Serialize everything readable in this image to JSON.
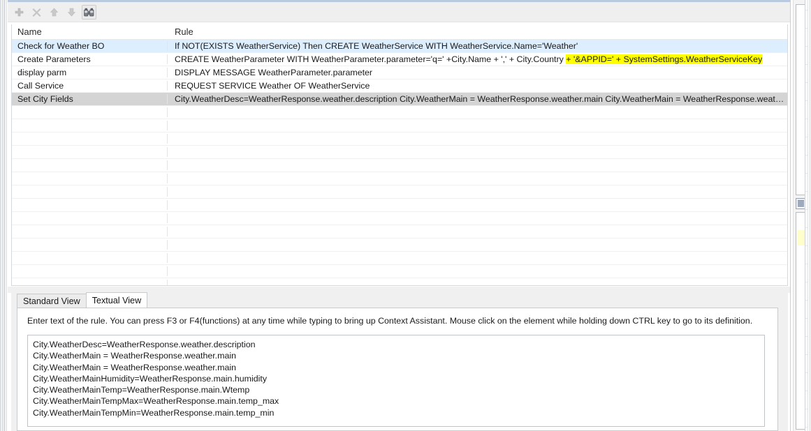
{
  "window": {
    "accent_color": "#b9c9de",
    "toolbar_bg": "#efefef"
  },
  "toolbar": {
    "buttons": [
      {
        "name": "add-rule-button",
        "icon": "plus-icon",
        "enabled": false,
        "framed": false
      },
      {
        "name": "delete-rule-button",
        "icon": "close-x-icon",
        "enabled": false,
        "framed": false
      },
      {
        "name": "move-up-button",
        "icon": "arrow-up-icon",
        "enabled": false,
        "framed": false
      },
      {
        "name": "move-down-button",
        "icon": "arrow-down-icon",
        "enabled": false,
        "framed": false
      },
      {
        "name": "find-button",
        "icon": "binoculars-icon",
        "enabled": true,
        "framed": true
      }
    ]
  },
  "rules_table": {
    "columns": [
      {
        "key": "name",
        "label": "Name"
      },
      {
        "key": "rule",
        "label": "Rule"
      }
    ],
    "highlight_color": "#ffff00",
    "row_selected_color": "#d4d4d4",
    "row_hover_color": "#ddeeff",
    "rows": [
      {
        "name": "Check for Weather BO",
        "rule_plain": "If NOT(EXISTS WeatherService) Then  CREATE WeatherService WITH WeatherService.Name='Weather'",
        "rule_pre": "If NOT(EXISTS WeatherService) Then  CREATE WeatherService WITH WeatherService.Name='Weather'",
        "rule_highlight": "",
        "rule_post": "",
        "state": "hover"
      },
      {
        "name": "Create Parameters",
        "rule_plain": "CREATE WeatherParameter WITH WeatherParameter.parameter='q=' +City.Name + ',' + City.Country + '&APPID=' + SystemSettings.WeatherServiceKey",
        "rule_pre": "CREATE WeatherParameter WITH WeatherParameter.parameter='q=' +City.Name + ',' + City.Country ",
        "rule_highlight": "+ '&APPID=' + SystemSettings.WeatherServiceKey",
        "rule_post": "",
        "state": "normal"
      },
      {
        "name": "display parm",
        "rule_plain": "DISPLAY MESSAGE WeatherParameter.parameter",
        "rule_pre": "DISPLAY MESSAGE WeatherParameter.parameter",
        "rule_highlight": "",
        "rule_post": "",
        "state": "normal"
      },
      {
        "name": "Call Service",
        "rule_plain": "REQUEST SERVICE Weather OF WeatherService",
        "rule_pre": "REQUEST SERVICE Weather OF WeatherService",
        "rule_highlight": "",
        "rule_post": "",
        "state": "normal"
      },
      {
        "name": "Set City Fields",
        "rule_plain": "City.WeatherDesc=WeatherResponse.weather.description  City.WeatherMain = WeatherResponse.weather.main  City.WeatherMain = WeatherResponse.weather.mai…",
        "rule_pre": "City.WeatherDesc=WeatherResponse.weather.description  City.WeatherMain = WeatherResponse.weather.main  City.WeatherMain = WeatherResponse.weather.mai…",
        "rule_highlight": "",
        "rule_post": "",
        "state": "selected"
      }
    ],
    "empty_row_count": 14
  },
  "bottom_panel": {
    "tabs": [
      {
        "label": "Standard View",
        "active": false
      },
      {
        "label": "Textual View",
        "active": true
      }
    ],
    "hint": "Enter text of the rule. You can press F3 or F4(functions) at any time while typing to bring up Context Assistant.  Mouse click on the element while holding down CTRL key to go to its definition.",
    "editor_lines": [
      "City.WeatherDesc=WeatherResponse.weather.description",
      "City.WeatherMain = WeatherResponse.weather.main",
      "City.WeatherMain = WeatherResponse.weather.main",
      "City.WeatherMainHumidity=WeatherResponse.main.humidity",
      "City.WeatherMainTemp=WeatherResponse.main.Wtemp",
      "City.WeatherMainTempMax=WeatherResponse.main.temp_max",
      "City.WeatherMainTempMin=WeatherResponse.main.temp_min"
    ]
  },
  "right_dock": {
    "tab_icon_name": "minimized-view-icon"
  }
}
